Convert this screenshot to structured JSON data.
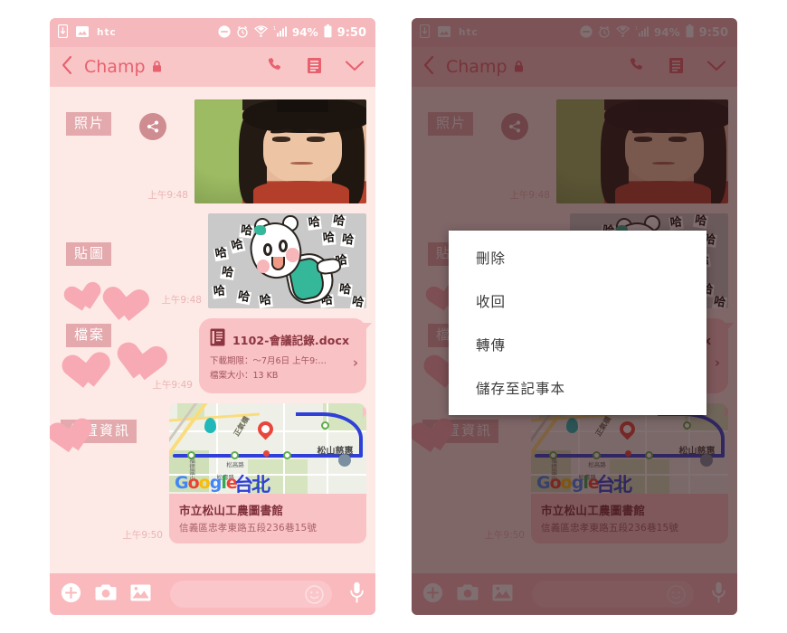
{
  "statusbar": {
    "carrier": "htc",
    "battery_percent": "94%",
    "time": "9:50",
    "icons": [
      "download-icon",
      "picture-icon",
      "dnd-icon",
      "alarm-icon",
      "wifi-icon",
      "signal-icon",
      "battery-icon"
    ]
  },
  "appbar": {
    "title": "Champ",
    "back_icon": "chevron-left-icon",
    "lock_icon": "lock-icon",
    "call_icon": "phone-icon",
    "menu_icon": "list-menu-icon",
    "collapse_icon": "chevron-down-icon"
  },
  "annotations": {
    "photo": "照片",
    "sticker": "貼圖",
    "file": "檔案",
    "location": "位置資訊"
  },
  "messages": {
    "photo": {
      "timestamp": "上午9:48",
      "share_icon": "share-icon"
    },
    "sticker": {
      "timestamp": "上午9:48",
      "text": "哈"
    },
    "file": {
      "name": "1102-會議記錄.docx",
      "expiry": "下載期限：～7月6日 上午9:…",
      "size": "檔案大小：13 KB",
      "timestamp": "上午9:49",
      "icon": "document-icon",
      "chevron": "›"
    },
    "location": {
      "name": "市立松山工農圖書館",
      "address": "信義區忠孝東路五段236巷15號",
      "timestamp": "上午9:50",
      "map_labels": {
        "road_diagonal": "正氣橋",
        "road_1": "松高路",
        "road_2": "松壽路",
        "area_right": "松山慈惠",
        "area_left": "福德國小",
        "watermark": "Google",
        "city": "台北"
      }
    }
  },
  "toolbar": {
    "plus_icon": "plus-circle-icon",
    "camera_icon": "camera-icon",
    "gallery_icon": "gallery-icon",
    "input_placeholder": "",
    "input_value": "",
    "emoji_icon": "emoji-smile-icon",
    "mic_icon": "microphone-icon"
  },
  "context_menu": {
    "items": [
      {
        "label": "刪除"
      },
      {
        "label": "收回"
      },
      {
        "label": "轉傳"
      },
      {
        "label": "儲存至記事本"
      }
    ]
  },
  "colors": {
    "statusbar": "#f5b8bc",
    "appbar": "#f9c6c8",
    "accent": "#e8616f",
    "chat_bg": "#fdeae6",
    "bubble": "#f9c2c4",
    "chip": "#e3a9ac",
    "toolbar": "#f9b9bd",
    "menu_bg": "#ffffff",
    "dim_overlay": "rgba(50,22,26,0.62)"
  }
}
